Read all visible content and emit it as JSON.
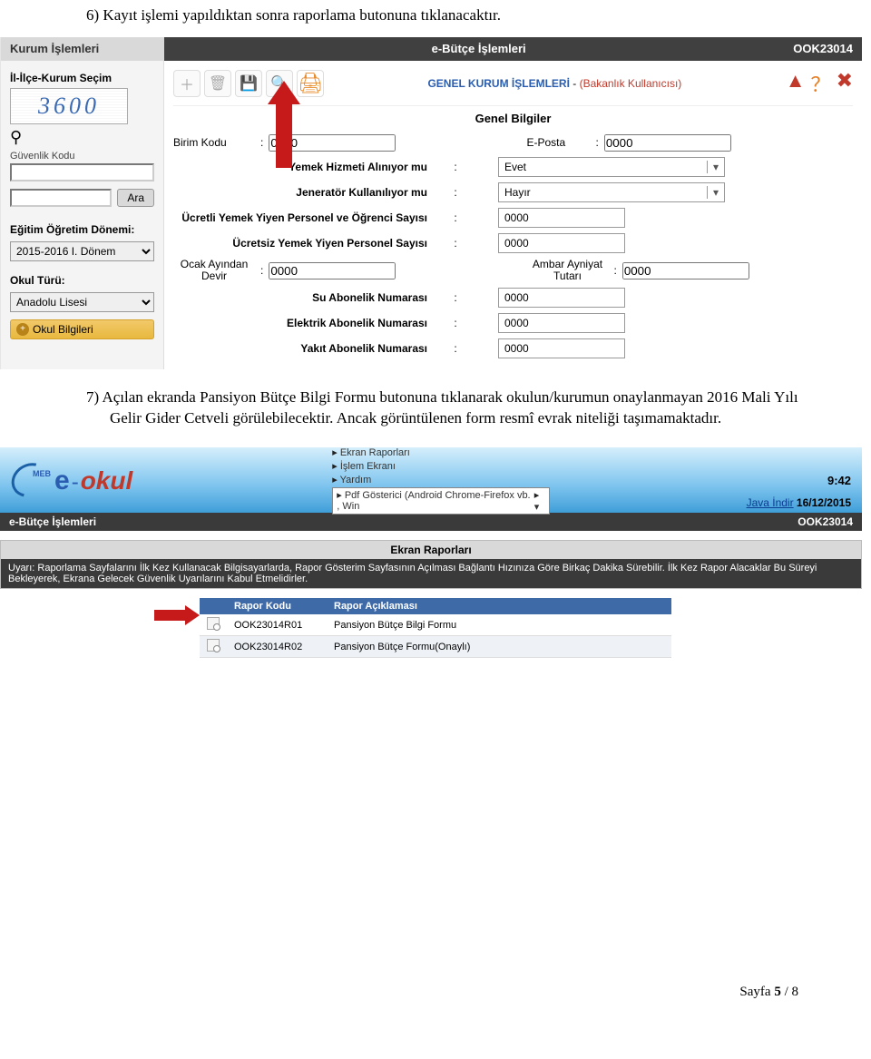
{
  "doc": {
    "step6": "6)  Kayıt işlemi yapıldıktan sonra raporlama butonuna tıklanacaktır.",
    "step7": "7)  Açılan ekranda Pansiyon Bütçe Bilgi Formu butonuna tıklanarak okulun/kurumun onaylanmayan 2016 Mali Yılı Gelir Gider Cetveli görülebilecektir. Ancak görüntülenen form resmî evrak niteliği taşımamaktadır.",
    "page": "Sayfa ",
    "page_cur": "5",
    "page_sep": " / ",
    "page_tot": "8"
  },
  "shot1": {
    "header": {
      "left": "Kurum İşlemleri",
      "center": "e-Bütçe İşlemleri",
      "right": "OOK23014"
    },
    "sidebar": {
      "secim": "İl-İlçe-Kurum Seçim",
      "captcha": "3600",
      "guvenlik": "Güvenlik Kodu",
      "ara": "Ara",
      "donem_lbl": "Eğitim Öğretim Dönemi:",
      "donem_val": "2015-2016 I. Dönem",
      "tur_lbl": "Okul Türü:",
      "tur_val": "Anadolu Lisesi",
      "accordion": "Okul Bilgileri"
    },
    "toolbar": {
      "breadcrumb1": "GENEL KURUM İŞLEMLERİ",
      "breadcrumb_sep": " - ",
      "breadcrumb2": "(Bakanlık Kullanıcısı)"
    },
    "section": "Genel Bilgiler",
    "fields": {
      "birim": {
        "label": "Birim Kodu",
        "value": "0000"
      },
      "eposta": {
        "label": "E-Posta",
        "value": "0000"
      },
      "yemek": {
        "label": "Yemek Hizmeti Alınıyor mu",
        "value": "Evet"
      },
      "jen": {
        "label": "Jeneratör Kullanılıyor mu",
        "value": "Hayır"
      },
      "ucretli": {
        "label": "Ücretli Yemek Yiyen Personel ve Öğrenci Sayısı",
        "value": "0000"
      },
      "ucretsiz": {
        "label": "Ücretsiz Yemek Yiyen Personel Sayısı",
        "value": "0000"
      },
      "ocak": {
        "label": "Ocak Ayından Devir",
        "value": "0000"
      },
      "ambar": {
        "label": "Ambar Ayniyat Tutarı",
        "value": "0000"
      },
      "su": {
        "label": "Su Abonelik Numarası",
        "value": "0000"
      },
      "elektrik": {
        "label": "Elektrik Abonelik Numarası",
        "value": "0000"
      },
      "yakit": {
        "label": "Yakıt Abonelik Numarası",
        "value": "0000"
      }
    }
  },
  "shot2": {
    "logo": {
      "meb": "MEB",
      "e": "e",
      "dash": "-",
      "okul": "okul"
    },
    "links": {
      "l1": "Ekran Raporları",
      "l2": "İşlem Ekranı",
      "l3": "Yardım"
    },
    "pdf_sel": "Pdf Gösterici (Android Chrome-Firefox vb. , Win",
    "time": "9:42",
    "java": "Java İndir",
    "date": " 16/12/2015",
    "bar": {
      "left": "e-Bütçe İşlemleri",
      "right": "OOK23014"
    },
    "panel_title": "Ekran Raporları",
    "warn": "Uyarı: Raporlama Sayfalarını İlk Kez Kullanacak Bilgisayarlarda, Rapor Gösterim Sayfasının Açılması Bağlantı Hızınıza Göre Birkaç Dakika Sürebilir. İlk Kez Rapor Alacaklar Bu Süreyi Bekleyerek, Ekrana Gelecek Güvenlik Uyarılarını Kabul Etmelidirler.",
    "table": {
      "h1": "Rapor Kodu",
      "h2": "Rapor Açıklaması",
      "r1c1": "OOK23014R01",
      "r1c2": "Pansiyon Bütçe Bilgi Formu",
      "r2c1": "OOK23014R02",
      "r2c2": "Pansiyon Bütçe Formu(Onaylı)"
    }
  }
}
